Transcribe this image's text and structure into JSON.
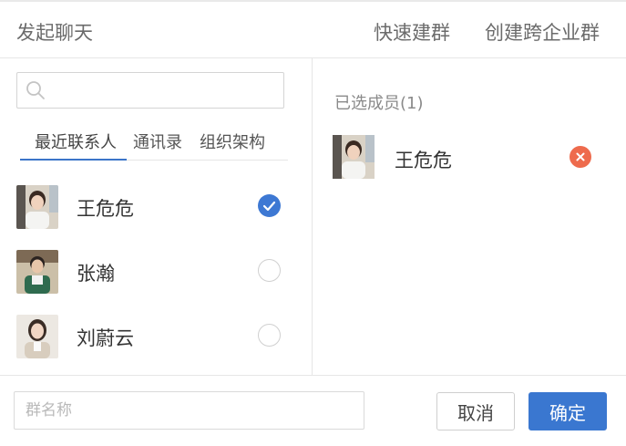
{
  "header": {
    "title": "发起聊天",
    "quick_group": "快速建群",
    "cross_org_group": "创建跨企业群"
  },
  "search": {
    "placeholder": "",
    "value": ""
  },
  "tabs": [
    {
      "label": "最近联系人",
      "active": true
    },
    {
      "label": "通讯录",
      "active": false
    },
    {
      "label": "组织架构",
      "active": false
    }
  ],
  "contacts": [
    {
      "name": "王危危",
      "selected": true
    },
    {
      "name": "张瀚",
      "selected": false
    },
    {
      "name": "刘蔚云",
      "selected": false
    }
  ],
  "selected_panel": {
    "title": "已选成员(1)",
    "members": [
      {
        "name": "王危危"
      }
    ]
  },
  "footer": {
    "group_name_placeholder": "群名称",
    "cancel_label": "取消",
    "confirm_label": "确定"
  },
  "colors": {
    "accent": "#3a77d0",
    "remove": "#ee6b4d",
    "divider": "#e6e6e6"
  }
}
